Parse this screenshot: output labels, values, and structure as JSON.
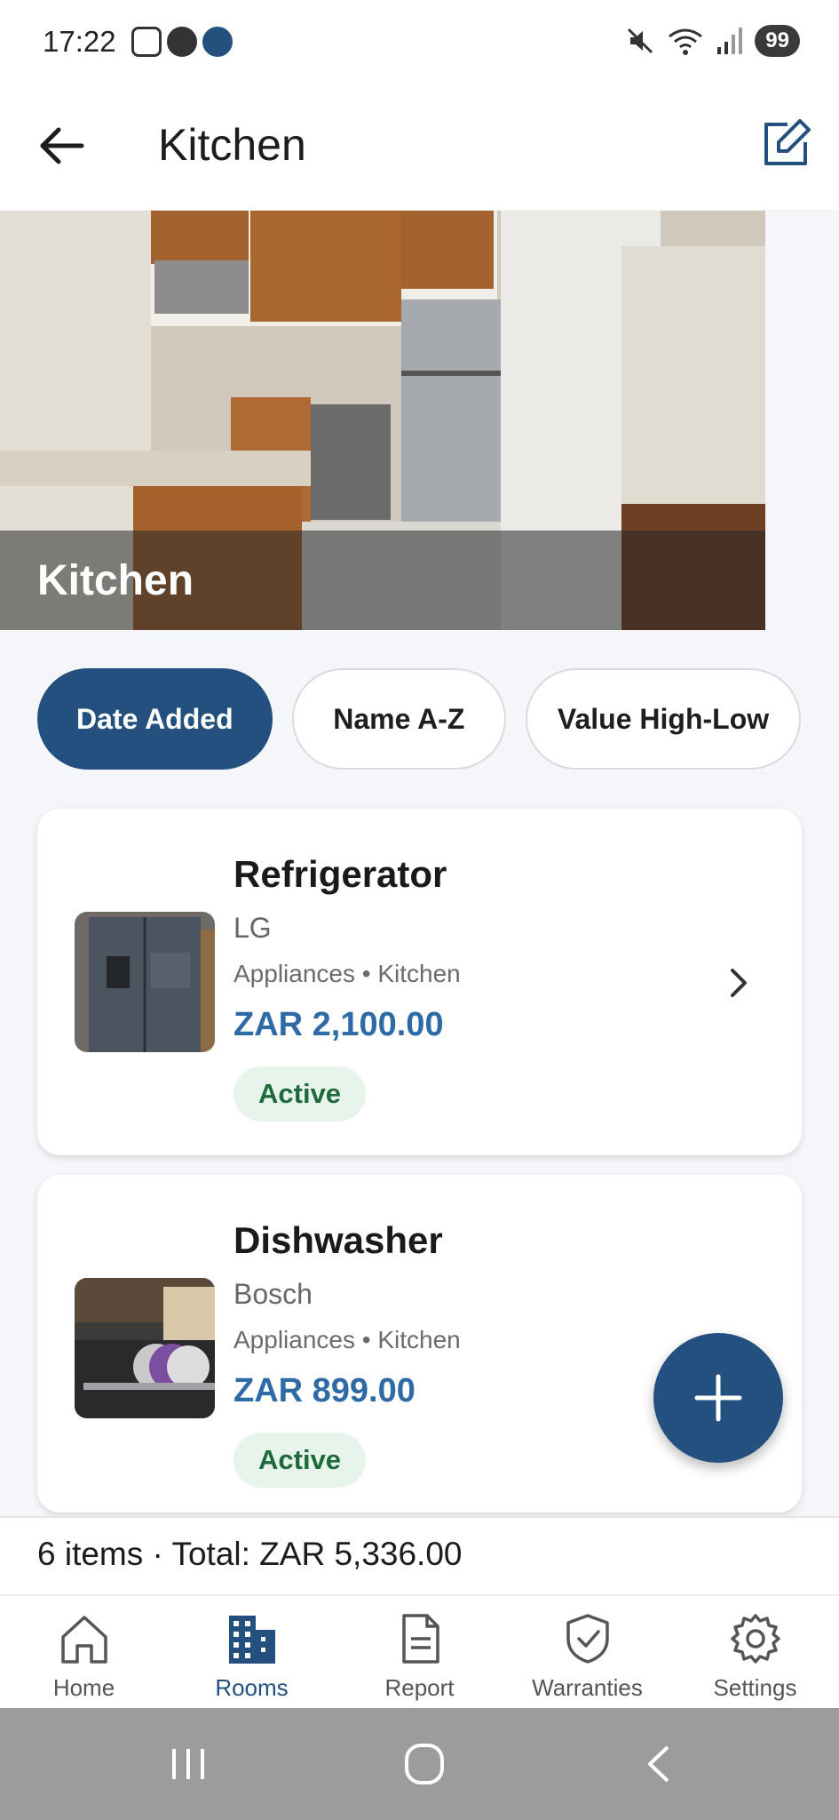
{
  "status_bar": {
    "time": "17:22",
    "battery": "99",
    "icons": [
      "screenshot-icon",
      "shield-check-icon",
      "home-badge-icon",
      "mute-icon",
      "wifi-icon",
      "signal-icon"
    ]
  },
  "app_bar": {
    "title": "Kitchen",
    "back_icon": "arrow-left-icon",
    "edit_icon": "edit-icon"
  },
  "hero": {
    "title": "Kitchen"
  },
  "sort_chips": [
    {
      "label": "Date Added",
      "active": true
    },
    {
      "label": "Name A-Z",
      "active": false
    },
    {
      "label": "Value High-Low",
      "active": false
    }
  ],
  "items": [
    {
      "name": "Refrigerator",
      "brand": "LG",
      "category": "Appliances • Kitchen",
      "price": "ZAR 2,100.00",
      "status": "Active"
    },
    {
      "name": "Dishwasher",
      "brand": "Bosch",
      "category": "Appliances • Kitchen",
      "price": "ZAR 899.00",
      "status": "Active"
    }
  ],
  "summary": {
    "text": "6 items · Total: ZAR 5,336.00"
  },
  "bottom_nav": [
    {
      "label": "Home",
      "icon": "home-icon",
      "active": false
    },
    {
      "label": "Rooms",
      "icon": "building-icon",
      "active": true
    },
    {
      "label": "Report",
      "icon": "document-icon",
      "active": false
    },
    {
      "label": "Warranties",
      "icon": "shield-check-icon",
      "active": false
    },
    {
      "label": "Settings",
      "icon": "gear-icon",
      "active": false
    }
  ],
  "colors": {
    "primary": "#23507e",
    "price": "#2e6aa6",
    "badge_bg": "#e7f4ec",
    "badge_text": "#1f6a3b",
    "background": "#f4f6f9"
  }
}
